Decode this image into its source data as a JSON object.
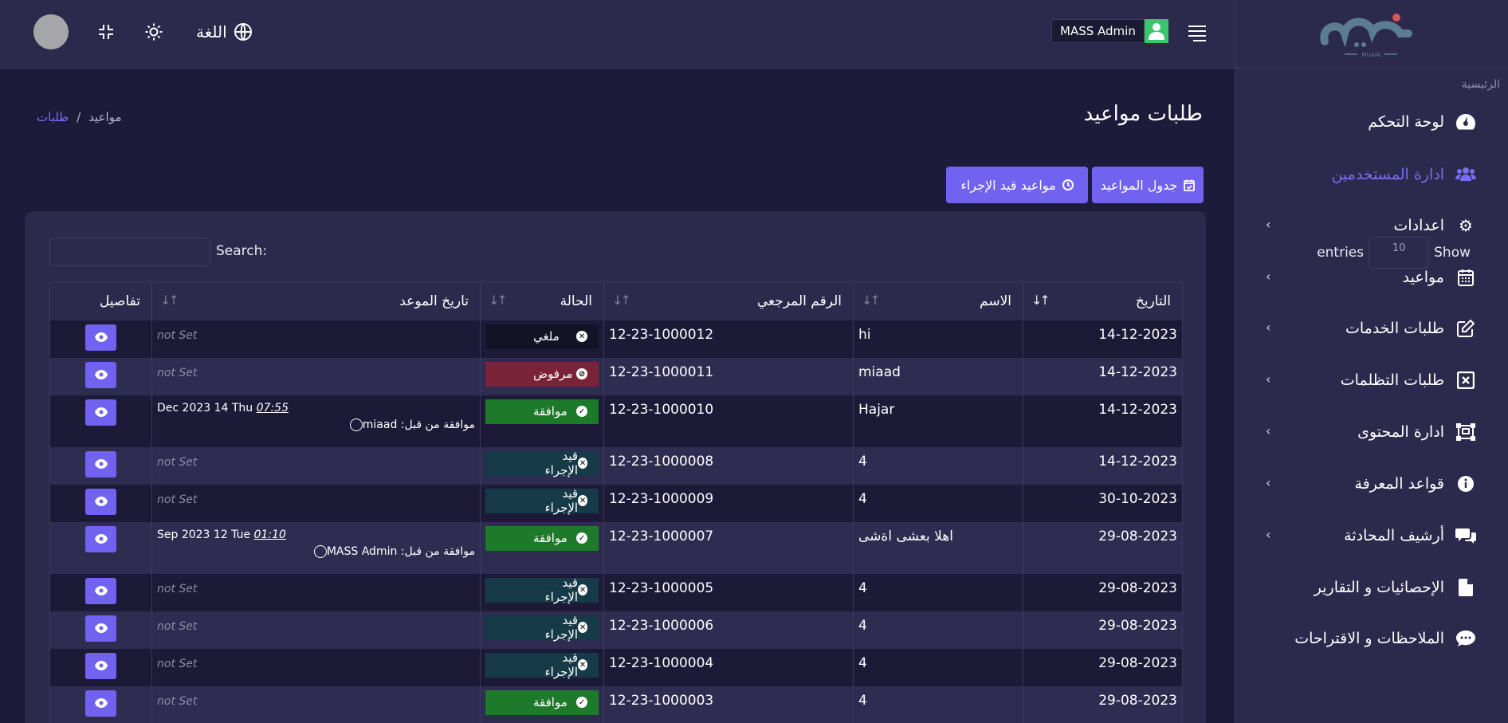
{
  "sidebar": {
    "logo_alt": "MUAIN",
    "home_label": "الرئيسية",
    "items": [
      {
        "label": "لوحة التحكم",
        "icon": "dashboard-icon",
        "active": false,
        "chevron": false
      },
      {
        "label": "ادارة المستخدمين",
        "icon": "users-icon",
        "active": true,
        "chevron": false
      },
      {
        "label": "اعدادات",
        "icon": "gear-icon",
        "active": false,
        "chevron": true
      },
      {
        "label": "مواعيد",
        "icon": "calendar-icon",
        "active": false,
        "chevron": true
      },
      {
        "label": "طلبات الخدمات",
        "icon": "edit-icon",
        "active": false,
        "chevron": true
      },
      {
        "label": "طلبات التظلمات",
        "icon": "x-square-icon",
        "active": false,
        "chevron": true
      },
      {
        "label": "ادارة المحتوى",
        "icon": "content-icon",
        "active": false,
        "chevron": true
      },
      {
        "label": "قواعد المعرفة",
        "icon": "info-icon",
        "active": false,
        "chevron": true
      },
      {
        "label": "أرشيف المحادثة",
        "icon": "chat-icon",
        "active": false,
        "chevron": true
      },
      {
        "label": "الإحصائيات و التقارير",
        "icon": "file-icon",
        "active": false,
        "chevron": false
      },
      {
        "label": "الملاحظات و الاقتراحات",
        "icon": "comment-icon",
        "active": false,
        "chevron": false
      }
    ]
  },
  "header": {
    "admin_name": "MASS Admin",
    "language_label": "اللغة"
  },
  "page": {
    "title": "طلبات مواعيد",
    "breadcrumb": [
      "طلبات",
      "/",
      "مواعيد"
    ],
    "btn_schedule": "جدول المواعيد",
    "btn_pending": "مواعيد قيد الإجراء"
  },
  "table_controls": {
    "show": "Show",
    "entries_value": "10",
    "entries": "entries",
    "search_label": "Search:"
  },
  "table": {
    "columns": [
      "التاريخ",
      "الاسم",
      "الرقم المرجعي",
      "الحالة",
      "تاريخ الموعد",
      "تفاصيل"
    ],
    "rows": [
      {
        "date": "14-12-2023",
        "name": "hi",
        "ref": "12-23-1000012",
        "status": "ملغي",
        "status_type": "cancel",
        "appt": null
      },
      {
        "date": "14-12-2023",
        "name": "miaad",
        "ref": "12-23-1000011",
        "status": "مرفوض",
        "status_type": "rejected",
        "appt": null
      },
      {
        "date": "14-12-2023",
        "name": "Hajar",
        "ref": "12-23-1000010",
        "status": "موافقة",
        "status_type": "approved",
        "appt": {
          "date": "Dec 2023 14 Thu",
          "time": "07:55",
          "by": "موافقة من قبل: miaad"
        }
      },
      {
        "date": "14-12-2023",
        "name": "4",
        "ref": "12-23-1000008",
        "status": "قيد الإجراء",
        "status_type": "pending",
        "appt": null
      },
      {
        "date": "30-10-2023",
        "name": "4",
        "ref": "12-23-1000009",
        "status": "قيد الإجراء",
        "status_type": "pending",
        "appt": null
      },
      {
        "date": "29-08-2023",
        "name": "اهلا بعشی اةشی",
        "ref": "12-23-1000007",
        "status": "موافقة",
        "status_type": "approved",
        "appt": {
          "date": "Sep 2023 12 Tue",
          "time": "01:10",
          "by": "موافقة من قبل: MASS Admin"
        }
      },
      {
        "date": "29-08-2023",
        "name": "4",
        "ref": "12-23-1000005",
        "status": "قيد الإجراء",
        "status_type": "pending",
        "appt": null
      },
      {
        "date": "29-08-2023",
        "name": "4",
        "ref": "12-23-1000006",
        "status": "قيد الإجراء",
        "status_type": "pending",
        "appt": null
      },
      {
        "date": "29-08-2023",
        "name": "4",
        "ref": "12-23-1000004",
        "status": "قيد الإجراء",
        "status_type": "pending",
        "appt": null
      },
      {
        "date": "29-08-2023",
        "name": "4",
        "ref": "12-23-1000003",
        "status": "موافقة",
        "status_type": "approved",
        "appt": null
      }
    ],
    "not_set": "not Set"
  },
  "colors": {
    "accent": "#7262f0",
    "background": "#1d1b3a",
    "panel": "#2b2a4c",
    "approved": "#1d7a2a",
    "rejected": "#7a2338",
    "pending": "#173a48"
  }
}
